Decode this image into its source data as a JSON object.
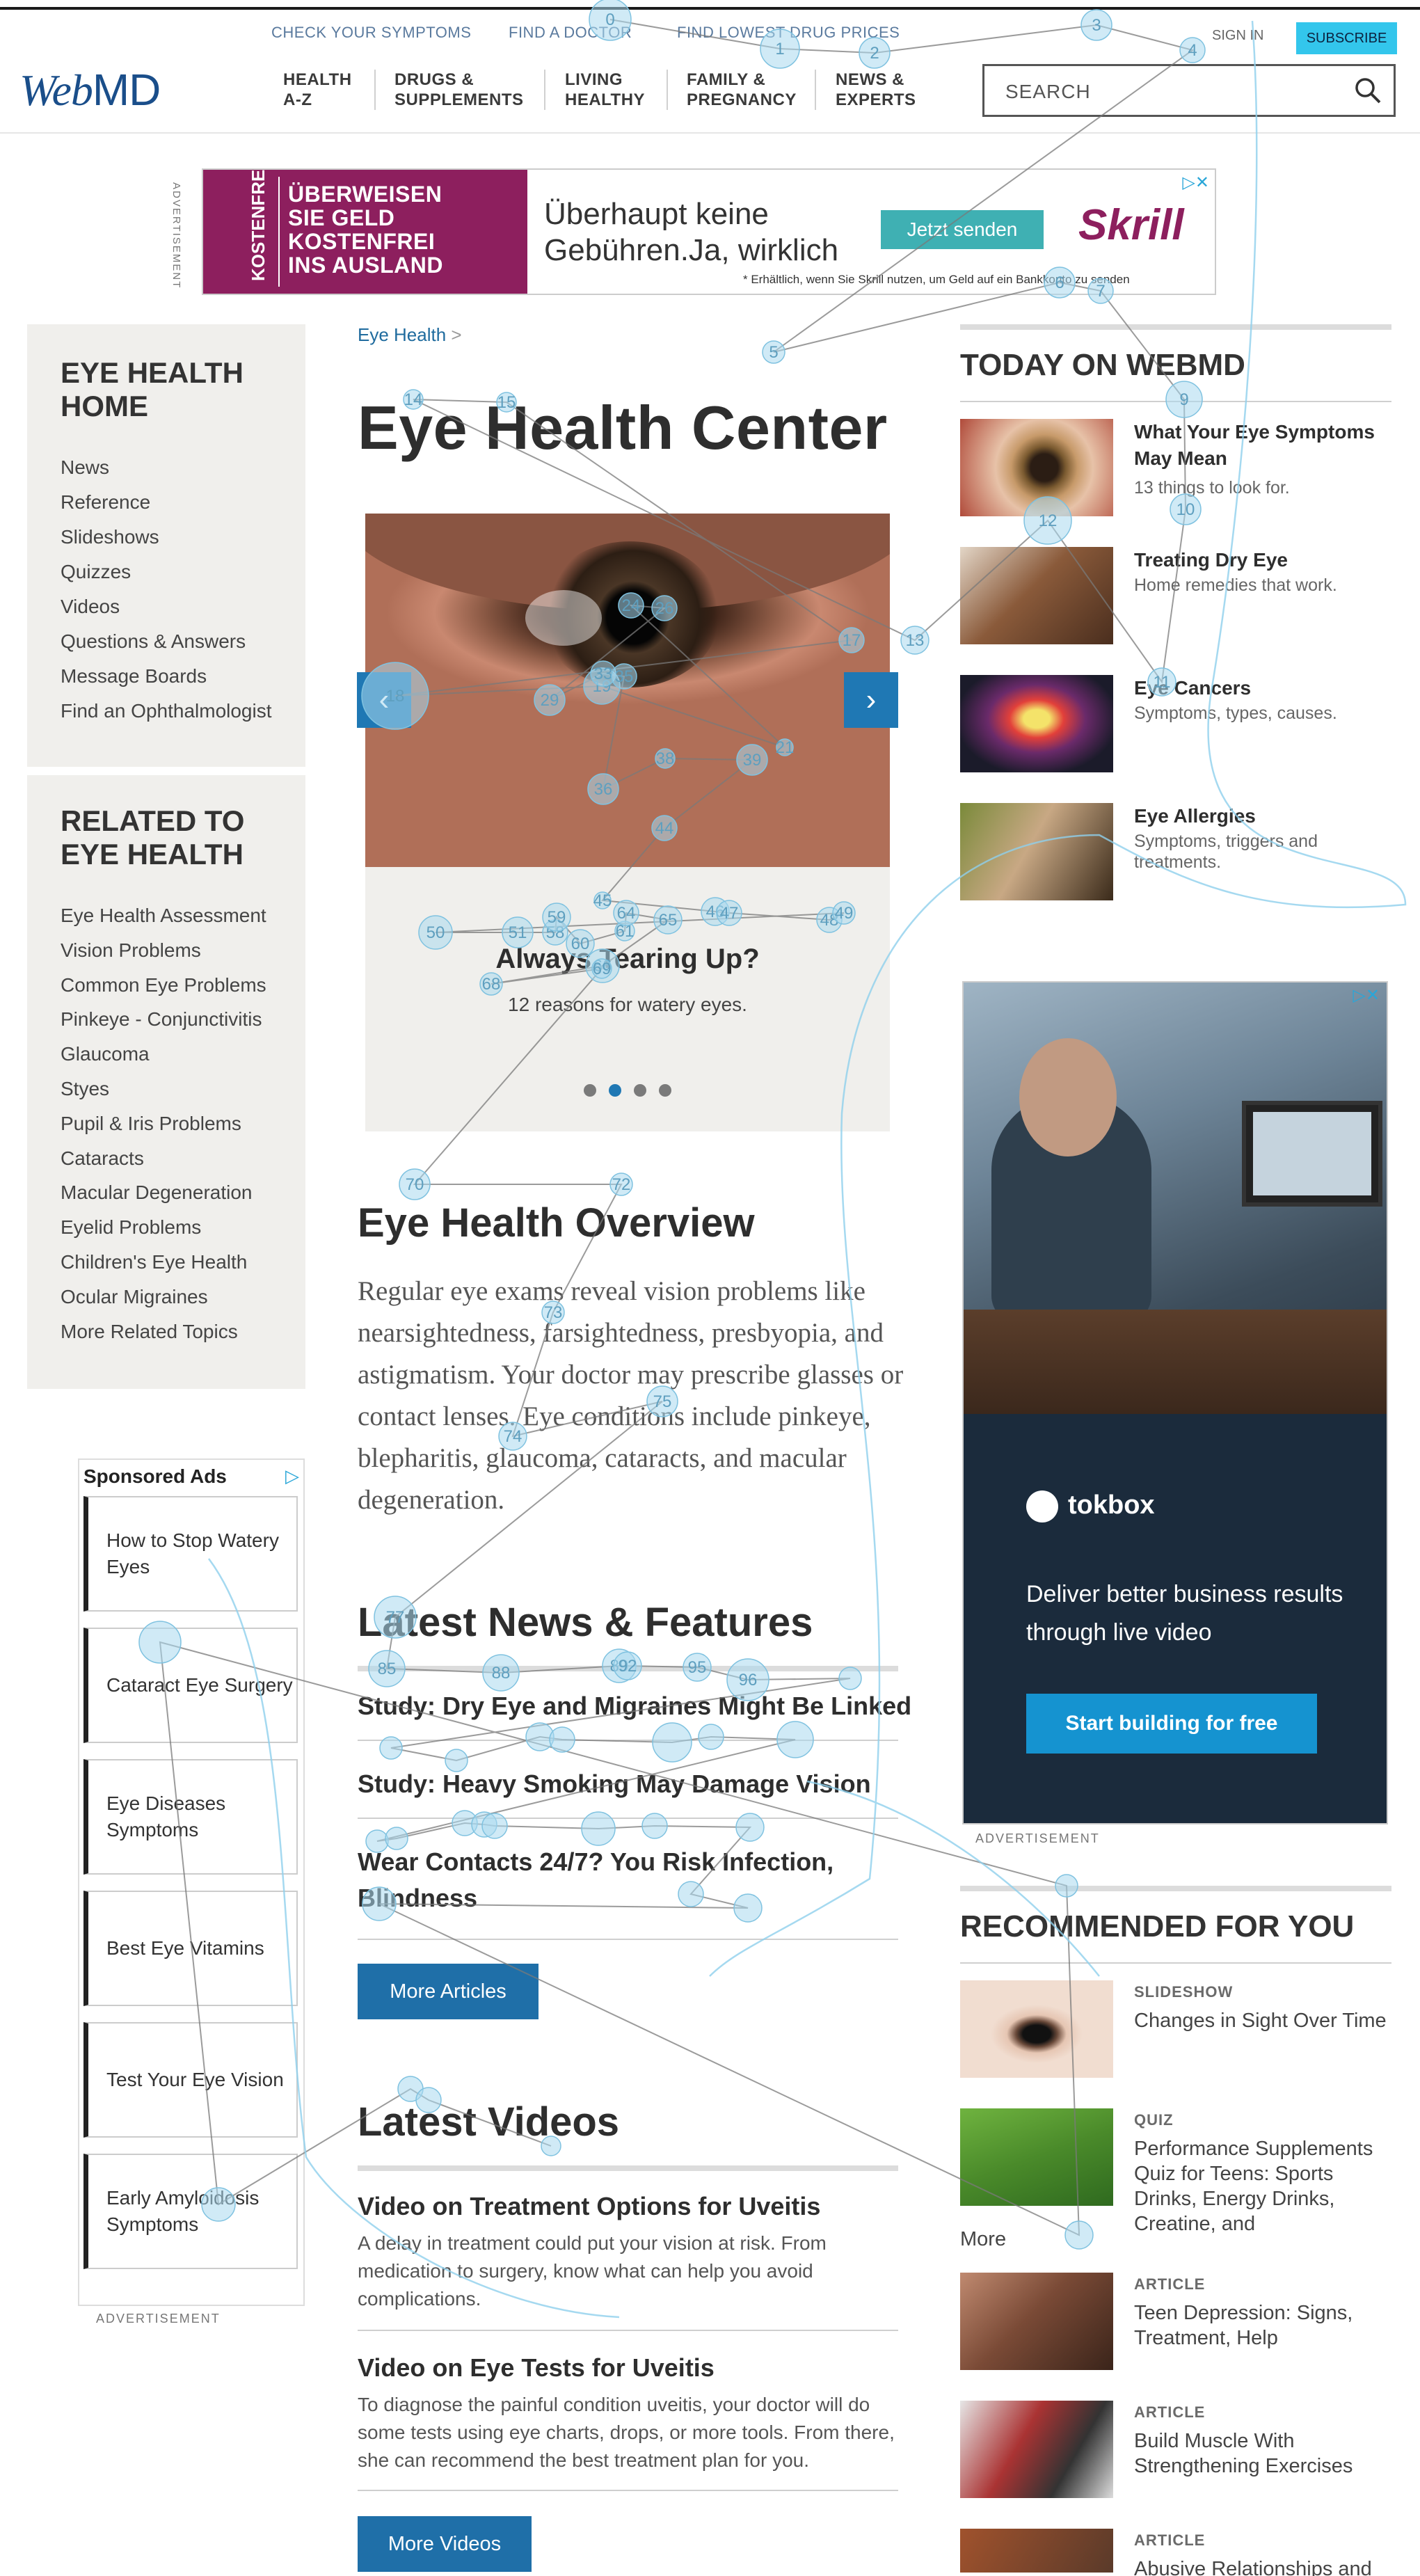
{
  "header": {
    "utility_links": [
      "CHECK YOUR SYMPTOMS",
      "FIND A DOCTOR",
      "FIND LOWEST DRUG PRICES"
    ],
    "sign_in": "SIGN IN",
    "subscribe": "SUBSCRIBE",
    "logo": {
      "web": "Web",
      "md": "MD"
    },
    "nav": [
      "HEALTH\nA-Z",
      "DRUGS &\nSUPPLEMENTS",
      "LIVING\nHEALTHY",
      "FAMILY &\nPREGNANCY",
      "NEWS &\nEXPERTS"
    ],
    "search_placeholder": "SEARCH"
  },
  "top_ad": {
    "tag": "KOSTENFREI",
    "slogan": "ÜBERWEISEN\nSIE GELD\nKOSTENFREI\nINS AUSLAND",
    "headline": "Überhaupt keine\nGebühren.Ja, wirklich",
    "cta": "Jetzt senden",
    "brand": "Skrill",
    "fine_print": "* Erhältlich, wenn Sie Skrill nutzen, um Geld auf ein Bankkonto zu senden",
    "label": "ADVERTISEMENT"
  },
  "left_sidebar": {
    "home_title": "EYE HEALTH\nHOME",
    "home_items": [
      "News",
      "Reference",
      "Slideshows",
      "Quizzes",
      "Videos",
      "Questions & Answers",
      "Message Boards",
      "Find an Ophthalmologist"
    ],
    "related_title": "RELATED TO\nEYE HEALTH",
    "related_items": [
      "Eye Health Assessment",
      "Vision Problems",
      "Common Eye Problems",
      "Pinkeye - Conjunctivitis",
      "Glaucoma",
      "Styes",
      "Pupil & Iris Problems",
      "Cataracts",
      "Macular Degeneration",
      "Eyelid Problems",
      "Children's Eye Health",
      "Ocular Migraines",
      "More Related Topics"
    ]
  },
  "main": {
    "breadcrumb": "Eye Health",
    "breadcrumb_sep": ">",
    "title": "Eye Health Center",
    "carousel": {
      "title": "Always Tearing Up?",
      "subtitle": "12 reasons for watery eyes.",
      "slide_count": 4,
      "active_slide": 2
    },
    "overview_heading": "Eye Health Overview",
    "overview_text": "Regular eye exams reveal vision problems like nearsightedness, farsightedness, presbyopia, and astigmatism. Your doctor may prescribe glasses or contact lenses. Eye conditions include pinkeye, blepharitis, glaucoma, cataracts, and macular degeneration.",
    "news_heading": "Latest News & Features",
    "news": [
      "Study: Dry Eye and Migraines Might Be Linked",
      "Study: Heavy Smoking May Damage Vision",
      "Wear Contacts 24/7? You Risk Infection, Blindness"
    ],
    "more_articles": "More Articles",
    "videos_heading": "Latest Videos",
    "videos": [
      {
        "title": "Video on Treatment Options for Uveitis",
        "desc": "A delay in treatment could put your vision at risk. From medication to surgery, know what can help you avoid complications."
      },
      {
        "title": "Video on Eye Tests for Uveitis",
        "desc": "To diagnose the painful condition uveitis, your doctor will do some tests using eye charts, drops, or more tools. From there, she can recommend the best treatment plan for you."
      }
    ],
    "more_videos": "More Videos"
  },
  "right": {
    "today_heading": "TODAY ON WEBMD",
    "today": [
      {
        "title": "What Your Eye Symptoms May Mean",
        "sub": "13 things to look for."
      },
      {
        "title": "Treating Dry Eye",
        "sub": "Home remedies that work."
      },
      {
        "title": "Eye Cancers",
        "sub": "Symptoms, types, causes."
      },
      {
        "title": "Eye Allergies",
        "sub": "Symptoms, triggers and treatments."
      }
    ],
    "ad": {
      "brand": "tokbox",
      "copy": "Deliver better business results through live video",
      "cta": "Start building for free",
      "label": "ADVERTISEMENT"
    },
    "recommended_heading": "RECOMMENDED FOR YOU",
    "recommended": [
      {
        "kicker": "SLIDESHOW",
        "title": "Changes in Sight Over Time"
      },
      {
        "kicker": "QUIZ",
        "title": "Performance Supplements Quiz for Teens: Sports Drinks, Energy Drinks, Creatine, and",
        "more": "More"
      },
      {
        "kicker": "ARTICLE",
        "title": "Teen Depression: Signs, Treatment, Help"
      },
      {
        "kicker": "ARTICLE",
        "title": "Build Muscle With Strengthening Exercises"
      },
      {
        "kicker": "ARTICLE",
        "title": "Abusive Relationships and"
      }
    ]
  },
  "sponsored": {
    "heading": "Sponsored Ads",
    "items": [
      "How to Stop Watery Eyes",
      "Cataract Eye Surgery",
      "Eye Diseases Symptoms",
      "Best Eye Vitamins",
      "Test Your Eye Vision",
      "Early Amyloidosis Symptoms"
    ],
    "label": "ADVERTISEMENT"
  },
  "gaze_overlay": {
    "labels": [
      "0",
      "1",
      "2",
      "3",
      "4",
      "5",
      "6",
      "7",
      "9",
      "10",
      "11",
      "12",
      "13",
      "14",
      "15",
      "17",
      "18",
      "19",
      "21",
      "24",
      "26",
      "29",
      "33",
      "35",
      "36",
      "38",
      "39",
      "44",
      "45",
      "46",
      "47",
      "48",
      "49",
      "50",
      "51",
      "58",
      "59",
      "60",
      "61",
      "64",
      "65",
      "66",
      "68",
      "69",
      "70",
      "72",
      "73",
      "74",
      "75",
      "77",
      "85",
      "88",
      "89",
      "92",
      "95",
      "96"
    ],
    "color": "#a9d8ee"
  }
}
